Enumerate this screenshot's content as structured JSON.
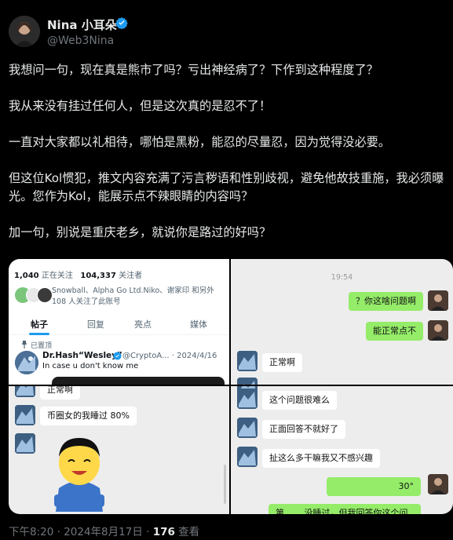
{
  "author": {
    "display_name": "Nina 小耳朵",
    "handle": "@Web3Nina"
  },
  "tweet": {
    "paragraphs": [
      "我想问一句，现在真是熊市了吗？亏出神经病了？下作到这种程度了？",
      "我从来没有挂过任何人，但是这次真的是忍不了！",
      "一直对大家都以礼相待，哪怕是黑粉，能忍的尽量忍，因为觉得没必要。",
      "但这位Kol惯犯，推文内容充满了污言秽语和性别歧视，避免他故技重施，我必须曝光。您作为Kol，能展示点不辣眼睛的内容吗？",
      "加一句，别说是重庆老乡，就说你是路过的好吗？"
    ]
  },
  "media": {
    "profile": {
      "following_count": "1,040",
      "following_label": "正在关注",
      "followers_count": "104,337",
      "followers_label": "关注者",
      "followed_by": "Snowball、Alpha Go Ltd.Niko、谢家印 和另外 108 人关注了此账号",
      "tabs": [
        "帖子",
        "回复",
        "亮点",
        "媒体"
      ],
      "pinned_label": "已置顶",
      "post_name": "Dr.Hash“Wesley”",
      "post_meta": "@CryptoA... · 2024/4/16",
      "post_text": "In case u don't know me"
    },
    "chat_top_right": {
      "time": "19:54",
      "msg_1": "？你这啥问题啊",
      "msg_2": "能正常点不",
      "msg_3": "正常啊"
    },
    "chat_bottom_left": {
      "msg_partial": "正常啊",
      "msg_1": "币圈女的我睡过 80%"
    },
    "chat_bottom_right": {
      "msg_1": "这个问题很难么",
      "msg_2": "正面回答不就好了",
      "msg_3": "扯这么多干嘛我又不感兴趣",
      "msg_4": "30°",
      "msg_5": "第…… 没睡过，但我回答你这个问"
    }
  },
  "footer": {
    "time": "下午8:20 · 2024年8月17日 · ",
    "views_count": "176",
    "views_label": " 查看"
  },
  "colors": {
    "background": "#000000",
    "text": "#e7e9ea",
    "muted": "#71767b",
    "verified": "#1d9bf0",
    "wechat_green": "#95ec69"
  }
}
